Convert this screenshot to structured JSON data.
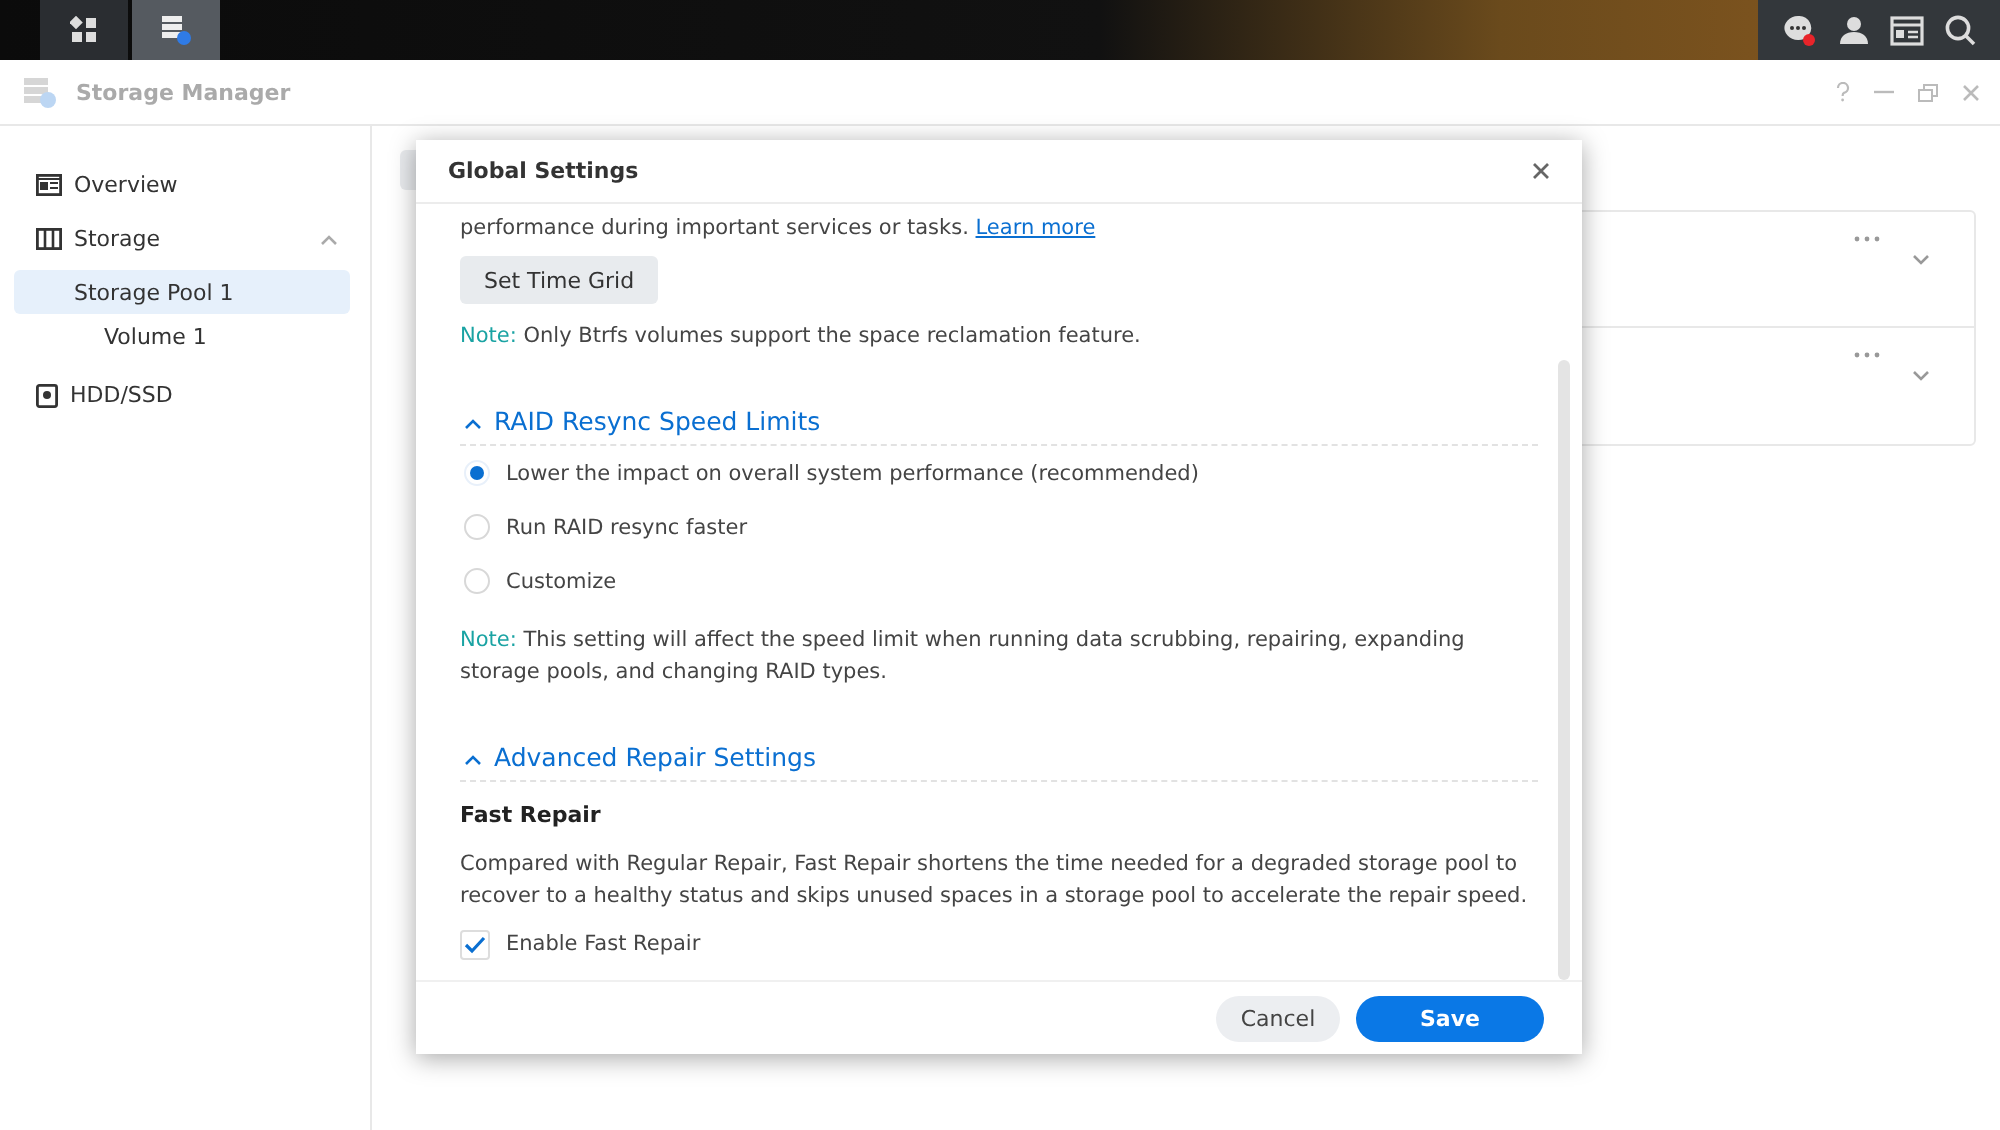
{
  "window": {
    "title": "Storage Manager"
  },
  "sidebar": {
    "items": [
      {
        "label": "Overview",
        "kind": "overview",
        "selected": false
      },
      {
        "label": "Storage",
        "kind": "storage",
        "selected": false,
        "expanded": true,
        "children": [
          {
            "label": "Storage Pool 1",
            "selected": true,
            "children": [
              {
                "label": "Volume 1",
                "selected": false
              }
            ]
          }
        ]
      },
      {
        "label": "HDD/SSD",
        "kind": "disk",
        "selected": false
      }
    ]
  },
  "cards": [
    {
      "expanded": false
    },
    {
      "expanded": false
    }
  ],
  "dialog": {
    "title": "Global Settings",
    "intro_text": "performance during important services or tasks.",
    "intro_link": "Learn more",
    "time_grid_button": "Set Time Grid",
    "note": {
      "label": "Note:",
      "text": "Only Btrfs volumes support the space reclamation feature."
    },
    "sections": [
      {
        "title": "RAID Resync Speed Limits",
        "expanded": true,
        "options": [
          {
            "label": "Lower the impact on overall system performance (recommended)",
            "selected": true
          },
          {
            "label": "Run RAID resync faster",
            "selected": false
          },
          {
            "label": "Customize",
            "selected": false
          }
        ],
        "note": {
          "label": "Note:",
          "text": "This setting will affect the speed limit when running data scrubbing, repairing, expanding storage pools, and changing RAID types."
        }
      },
      {
        "title": "Advanced Repair Settings",
        "expanded": true,
        "subheading": "Fast Repair",
        "description": "Compared with Regular Repair, Fast Repair shortens the time needed for a degraded storage pool to recover to a healthy status and skips unused spaces in a storage pool to accelerate the repair speed.",
        "checkbox": {
          "label": "Enable Fast Repair",
          "checked": true
        }
      }
    ],
    "buttons": [
      {
        "label": "Cancel",
        "kind": "secondary"
      },
      {
        "label": "Save",
        "kind": "primary"
      }
    ]
  }
}
